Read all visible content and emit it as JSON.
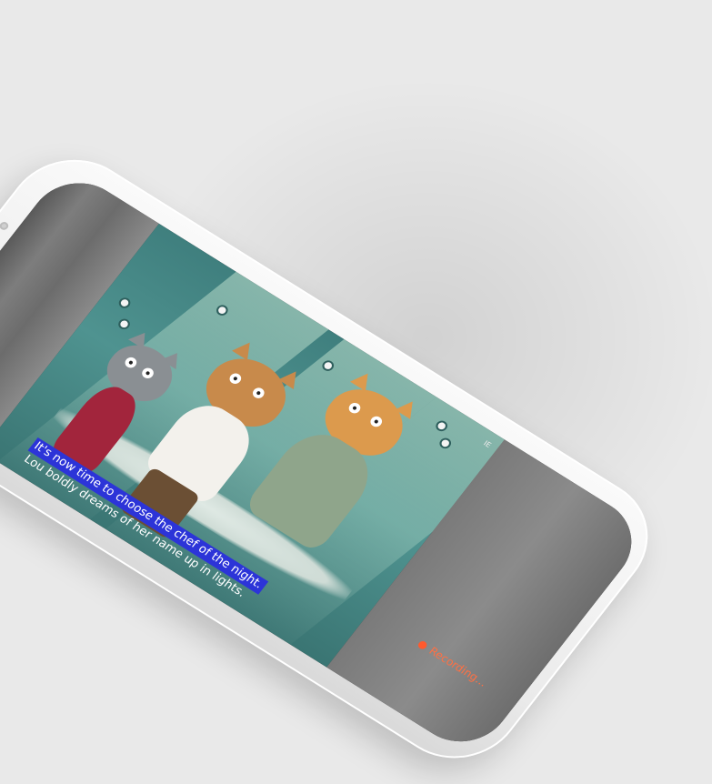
{
  "story": {
    "caption_active": "It's now time to choose the chef of the night.",
    "caption_next": "Lou boldly dreams of her name up in lights.",
    "corner_mark": "IE"
  },
  "recording": {
    "label": "Recording..."
  },
  "colors": {
    "highlight": "#2c34d8",
    "recording": "#ff7043",
    "scene_teal": "#4f9390"
  },
  "icons": {
    "recording": "red-dot-icon"
  }
}
